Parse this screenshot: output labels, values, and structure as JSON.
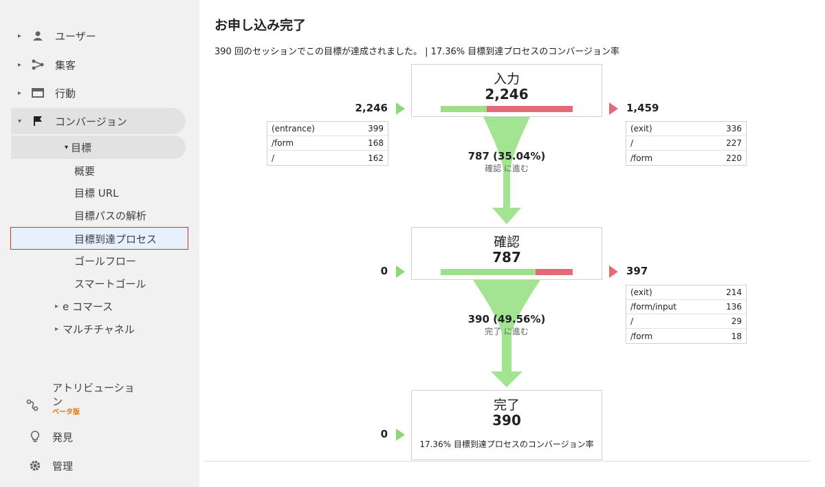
{
  "sidebar": {
    "items": [
      {
        "label": "ユーザー",
        "icon": "person-icon"
      },
      {
        "label": "集客",
        "icon": "acquisition-icon"
      },
      {
        "label": "行動",
        "icon": "behavior-icon"
      },
      {
        "label": "コンバージョン",
        "icon": "flag-icon"
      }
    ],
    "goal_label": "目標",
    "goal_sub": [
      "概要",
      "目標 URL",
      "目標パスの解析",
      "目標到達プロセス",
      "ゴールフロー",
      "スマートゴール"
    ],
    "ecommerce": "e コマース",
    "multichannel": "マルチチャネル",
    "attribution_line1": "アトリビューショ",
    "attribution_line2": "ン",
    "attribution_beta": "ベータ版",
    "discover": "発見",
    "admin": "管理"
  },
  "main": {
    "title": "お申し込み完了",
    "summary": "390 回のセッションでこの目標が達成されました。 | 17.36% 目標到達プロセスのコンバージョン率"
  },
  "funnel": {
    "steps": [
      {
        "name": "入力",
        "value": "2,246",
        "entrances": "2,246",
        "exits": "1,459",
        "proceed_fraction": 0.3504,
        "entrance_rows": [
          [
            "(entrance)",
            "399"
          ],
          [
            "/form",
            "168"
          ],
          [
            "/",
            "162"
          ]
        ],
        "exit_rows": [
          [
            "(exit)",
            "336"
          ],
          [
            "/",
            "227"
          ],
          [
            "/form",
            "220"
          ]
        ]
      },
      {
        "name": "確認",
        "value": "787",
        "entrances": "0",
        "exits": "397",
        "proceed_fraction": 0.4956,
        "exit_rows": [
          [
            "(exit)",
            "214"
          ],
          [
            "/form/input",
            "136"
          ],
          [
            "/",
            "29"
          ],
          [
            "/form",
            "18"
          ]
        ]
      },
      {
        "name": "完了",
        "value": "390",
        "entrances": "0",
        "conversion_text": "17.36% 目標到達プロセスのコンバージョン率"
      }
    ],
    "flows": [
      {
        "value": "787 (35.04%)",
        "label": "確認 に進む"
      },
      {
        "value": "390 (49.56%)",
        "label": "完了 に進む"
      }
    ]
  },
  "colors": {
    "proceed": "#9ee08a",
    "exit": "#e36a76",
    "funnel": "#a3e493",
    "alert_border": "#d93025"
  }
}
